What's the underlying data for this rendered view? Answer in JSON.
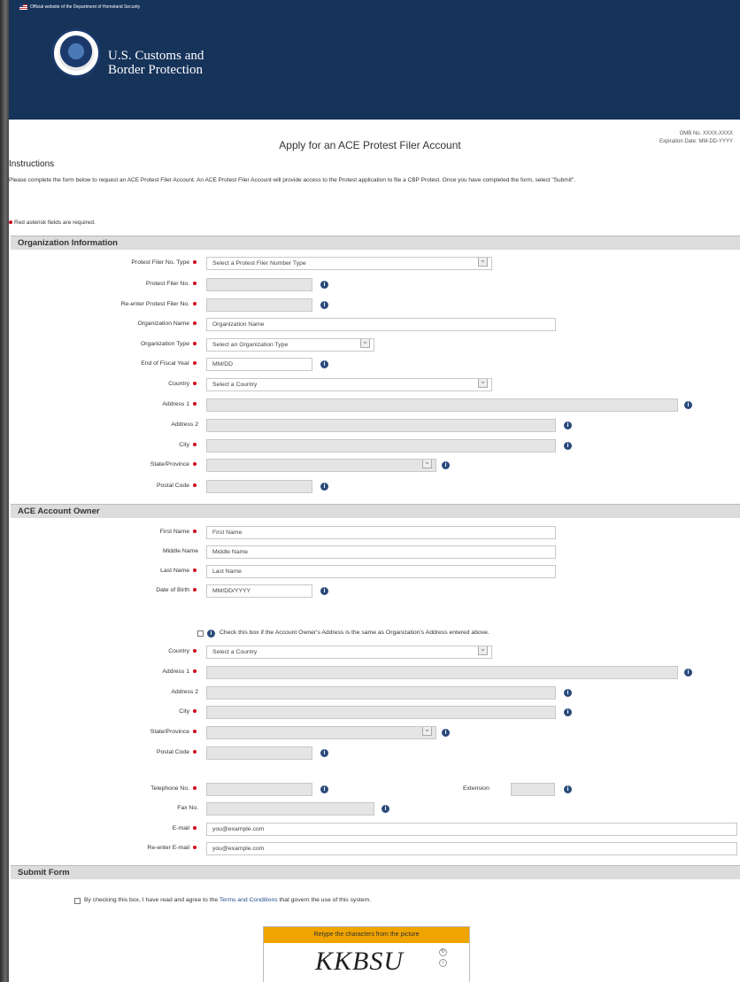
{
  "header": {
    "gov_banner": "Official website of the Department of Homeland Security",
    "agency_line1": "U.S. Customs and",
    "agency_line2": "Border Protection"
  },
  "page": {
    "title": "Apply for an ACE Protest Filer Account",
    "omb_line1": "OMB No. XXXX-XXXX",
    "omb_line2": "Expiration Date: MM-DD-YYYY",
    "instructions_heading": "Instructions",
    "instructions_text": "Please complete the form below to request an ACE Protest Filer Account. An ACE Protest Filer Account will provide access to the Protest application to file a CBP Protest. Once you have completed the form, select \"Submit\".",
    "required_note": "Red asterisk fields are required."
  },
  "org_section": {
    "title": "Organization Information",
    "fields": [
      {
        "label": "Protest Filer No. Type",
        "value": "Select a Protest Filer Number Type"
      },
      {
        "label": "Protest Filer No.",
        "value": ""
      },
      {
        "label": "Re-enter Protest Filer No.",
        "value": ""
      },
      {
        "label": "Organization Name",
        "value": "Organization Name"
      },
      {
        "label": "Organization Type",
        "value": "Select an Organization Type"
      },
      {
        "label": "End of Fiscal Year",
        "value": "MM/DD"
      },
      {
        "label": "Country",
        "value": "Select a Country"
      },
      {
        "label": "Address 1",
        "value": ""
      },
      {
        "label": "Address 2",
        "value": ""
      },
      {
        "label": "City",
        "value": ""
      },
      {
        "label": "State/Province",
        "value": ""
      },
      {
        "label": "Postal Code",
        "value": ""
      }
    ]
  },
  "owner_section": {
    "title": "ACE Account Owner",
    "fields": [
      {
        "label": "First Name",
        "value": "First Name"
      },
      {
        "label": "Middle Name",
        "value": "Middle Name"
      },
      {
        "label": "Last Name",
        "value": "Last Name"
      },
      {
        "label": "Date of Birth",
        "value": "MM/DD/YYYY"
      }
    ],
    "same_address_text": "Check this box if the Account Owner's Address is the same as Organization's Address entered above.",
    "address_fields": [
      {
        "label": "Country",
        "value": "Select a Country"
      },
      {
        "label": "Address 1",
        "value": ""
      },
      {
        "label": "Address 2",
        "value": ""
      },
      {
        "label": "City",
        "value": ""
      },
      {
        "label": "State/Province",
        "value": ""
      },
      {
        "label": "Postal Code",
        "value": ""
      }
    ],
    "contact_fields": [
      {
        "label": "Telephone No.",
        "value": ""
      },
      {
        "label": "Fax No.",
        "value": ""
      },
      {
        "label": "E-mail",
        "value": "you@example.com"
      },
      {
        "label": "Re-enter E-mail",
        "value": "you@example.com"
      }
    ],
    "extension_label": "Extension"
  },
  "submit_section": {
    "title": "Submit Form",
    "terms_before": "By checking this box, I have read and agree to the ",
    "terms_link": "Terms and Conditions",
    "terms_after": " that govern the use of this system.",
    "captcha_prompt": "Retype the characters from the picture",
    "captcha_code": "KKBSU"
  },
  "colors": {
    "header_bg": "#16335a",
    "required_dot": "#d0021b",
    "captcha_bar": "#f0a400"
  }
}
